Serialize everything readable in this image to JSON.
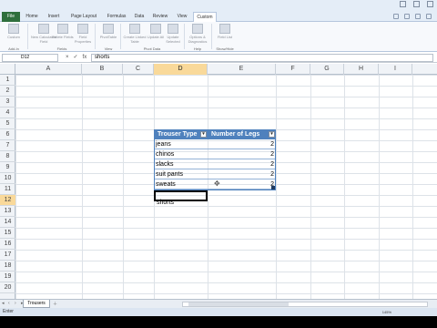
{
  "window": {
    "title": ""
  },
  "tabs": [
    "File",
    "Home",
    "Insert",
    "Page Layout",
    "Formulas",
    "Data",
    "Review",
    "View",
    "Custom"
  ],
  "active_tab": "Custom",
  "ribbon": {
    "buttons": [
      "Custom",
      "New Calculated Field",
      "Delete Fields",
      "Field Properties",
      "PivotTable",
      "Create Linked Table",
      "Update All",
      "Update Selected",
      "Options & Diagnostics",
      "Field List"
    ],
    "groups": [
      "Add-In",
      "Fields",
      "View",
      "Pivot Data",
      "Help",
      "Show/Hide"
    ]
  },
  "formula_bar": {
    "name_box": "D12",
    "fx_symbols": [
      "×",
      "✓",
      "fx"
    ],
    "value": "shorts"
  },
  "columns": [
    "A",
    "B",
    "C",
    "D",
    "E",
    "F",
    "G",
    "H",
    "I"
  ],
  "selected_column": "D",
  "rows": [
    "1",
    "2",
    "3",
    "4",
    "5",
    "6",
    "7",
    "8",
    "9",
    "10",
    "11",
    "12",
    "13",
    "14",
    "15",
    "16",
    "17",
    "18",
    "19",
    "20"
  ],
  "selected_row": "12",
  "table": {
    "headers": [
      "Trouser Type",
      "Number of Legs"
    ],
    "rows": [
      [
        "jeans",
        "2"
      ],
      [
        "chinos",
        "2"
      ],
      [
        "slacks",
        "2"
      ],
      [
        "suit pants",
        "2"
      ],
      [
        "sweats",
        "2"
      ]
    ],
    "editing_cell": "shorts"
  },
  "sheet_tabs": [
    "Trousers"
  ],
  "status": {
    "mode": "Enter",
    "zoom": "145%"
  },
  "colors": {
    "table_header": "#4f81bd",
    "selection": "#f9d99a",
    "file_tab": "#2e6f3c"
  }
}
